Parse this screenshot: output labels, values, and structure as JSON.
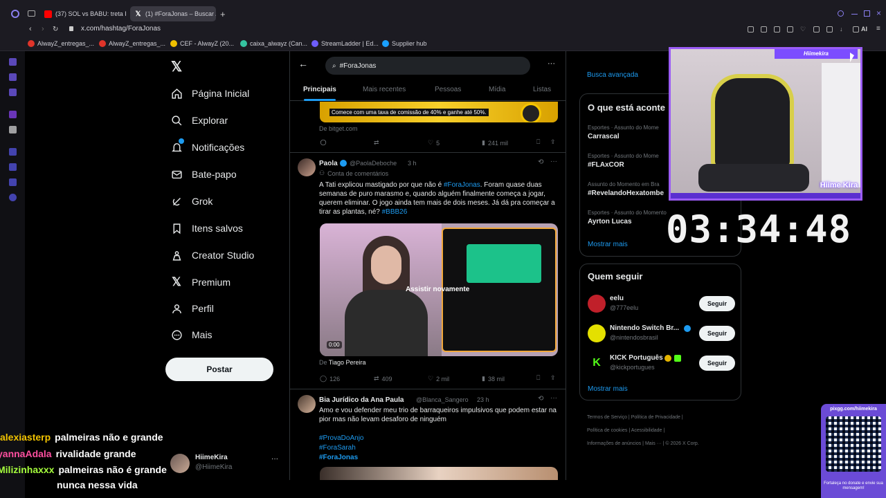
{
  "browser": {
    "tabs": [
      {
        "label": "(37) SOL vs BABU: treta Pl",
        "color": "#ff0000"
      },
      {
        "label": "(1) #ForaJonas – Buscar /",
        "color": "#ffffff"
      }
    ],
    "url": "x.com/hashtag/ForaJonas",
    "bookmarks": [
      {
        "label": "AlwayZ_entregas_...",
        "color": "#e0342a"
      },
      {
        "label": "AlwayZ_entregas_...",
        "color": "#e0342a"
      },
      {
        "label": "CEF - AlwayZ (20...",
        "color": "#f0c000"
      },
      {
        "label": "caixa_alwayz (Can...",
        "color": "#35c3a0"
      },
      {
        "label": "StreamLadder | Ed...",
        "color": "#6d5dfc"
      },
      {
        "label": "Supplier hub",
        "color": "#1aa0ff"
      }
    ],
    "ai_label": "AI"
  },
  "nav": {
    "items": [
      {
        "label": "Página Inicial",
        "icon": "home-icon"
      },
      {
        "label": "Explorar",
        "icon": "search-icon"
      },
      {
        "label": "Notificações",
        "icon": "bell-icon"
      },
      {
        "label": "Bate-papo",
        "icon": "mail-icon"
      },
      {
        "label": "Grok",
        "icon": "grok-icon"
      },
      {
        "label": "Itens salvos",
        "icon": "bookmark-icon"
      },
      {
        "label": "Creator Studio",
        "icon": "creator-icon"
      },
      {
        "label": "Premium",
        "icon": "x-icon"
      },
      {
        "label": "Perfil",
        "icon": "user-icon"
      },
      {
        "label": "Mais",
        "icon": "more-icon"
      }
    ],
    "post_label": "Postar",
    "account": {
      "name": "HiimeKira",
      "handle": "@HiimeKira"
    }
  },
  "main": {
    "search_value": "#ForaJonas",
    "tabs": [
      "Principais",
      "Mais recentes",
      "Pessoas",
      "Mídia",
      "Listas"
    ],
    "ad": {
      "banner_text": "Comece com uma taxa de comissão de 40% e ganhe até 50%.",
      "source": "De bitget.com",
      "likes": "5",
      "views": "241 mil"
    },
    "tweet1": {
      "name": "Paola",
      "handle": "@PaolaDeboche",
      "time": "3 h",
      "context": "Conta de comentários",
      "text_a": "A Tati explicou mastigado por que não é ",
      "hashtag_a": "#ForaJonas",
      "text_b": ". Foram quase duas semanas de puro marasmo e, quando alguém finalmente começa a jogar, querem eliminar. O jogo ainda tem mais de dois meses. Já dá pra começar a tirar as plantas, né? ",
      "hashtag_b": "#BBB26",
      "video_overlay": "Assistir novamente",
      "video_time": "0:00",
      "video_credit_prefix": "De",
      "video_credit": "Tiago Pereira",
      "replies": "126",
      "retweets": "409",
      "likes": "2 mil",
      "views": "38 mil"
    },
    "tweet2": {
      "name": "Bia Jurídico da Ana Paula",
      "handle": "@Blanca_Sangero",
      "time": "23 h",
      "text": "Amo e vou defender meu trio de barraqueiros impulsivos que podem estar na pior mas não levam desaforo de ninguém",
      "hashtags": [
        "#ProvaDoAnjo",
        "#ForaSarah",
        "#ForaJonas"
      ]
    }
  },
  "right": {
    "advanced_search": "Busca avançada",
    "trends_title": "O que está aconte",
    "trends": [
      {
        "category": "Esportes · Assunto do Mome",
        "name": "Carrascal"
      },
      {
        "category": "Esportes · Assunto do Mome",
        "name": "#FLAxCOR"
      },
      {
        "category": "Assunto do Momento em Bra",
        "name": "#RevelandoHexatombe"
      },
      {
        "category": "Esportes · Assunto do Momento",
        "name": "Ayrton Lucas"
      }
    ],
    "show_more": "Mostrar mais",
    "follow_title": "Quem seguir",
    "follow": [
      {
        "name": "eelu",
        "handle": "@777eelu",
        "color": "#c0202a"
      },
      {
        "name": "Nintendo Switch Br...",
        "handle": "@nintendosbrasil",
        "color": "#e4e000"
      },
      {
        "name": "KICK Português",
        "handle": "@kickportugues",
        "color": "#53fc18"
      }
    ],
    "follow_label": "Seguir",
    "footer": [
      "Termos de Serviço",
      "Política de Privacidade",
      "Política de cookies",
      "Acessibilidade",
      "Informações de anúncios",
      "Mais ···",
      "© 2026 X Corp."
    ]
  },
  "stream": {
    "chat": [
      {
        "user": "alexiasterp",
        "message": "palmeiras não e grande",
        "color": "#f2c300"
      },
      {
        "user": "yannaAdala",
        "message": "rivalidade grande",
        "color": "#ff4fa0"
      },
      {
        "user": "Milizinhaxxx",
        "message": "palmeiras não é grande",
        "color": "#a6ff3d"
      },
      {
        "user": "",
        "message": "nunca nessa vida",
        "color": "#ffffff"
      }
    ],
    "cam_label": "Hiimekira",
    "cam_logo": "Hiime Kira",
    "timer": "03:34:48",
    "qr_url": "pixgg.com/hiimekira",
    "qr_caption": "Fortaleça no donate e envie sua mensagem!"
  }
}
